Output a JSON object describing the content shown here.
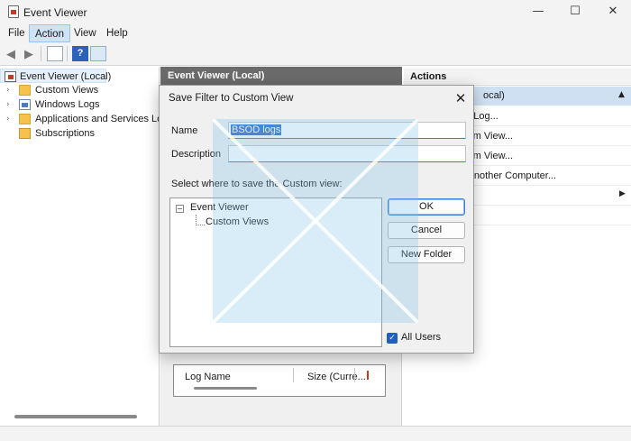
{
  "window": {
    "title": "Event Viewer",
    "controls": {
      "minimize": "—",
      "maximize": "☐",
      "close": "✕"
    }
  },
  "menu": {
    "items": [
      "File",
      "Action",
      "View",
      "Help"
    ]
  },
  "toolbar": {
    "buttons": [
      "back-arrow",
      "forward-arrow",
      "show-hide-tree",
      "help",
      "show-hide-action-pane"
    ],
    "help_glyph": "?"
  },
  "tree": {
    "items": [
      {
        "label": "Event Viewer (Local)",
        "icon": "event-viewer-icon"
      },
      {
        "label": "Custom Views",
        "icon": "folder-icon"
      },
      {
        "label": "Windows Logs",
        "icon": "logs-icon"
      },
      {
        "label": "Applications and Services Log",
        "icon": "folder-icon"
      },
      {
        "label": "Subscriptions",
        "icon": "subscriptions-icon"
      }
    ]
  },
  "center": {
    "header": "Event Viewer (Local)",
    "grid": {
      "col_name": "Log Name",
      "col_size": "Size (Curre..."
    }
  },
  "actions": {
    "header": "Actions",
    "section": "ocal)",
    "items": [
      "ed Log...",
      "stom View...",
      "stom View...",
      "o Another Computer..."
    ]
  },
  "dialog": {
    "title": "Save Filter to Custom View",
    "close_glyph": "✕",
    "name_label": "Name",
    "name_value": "BSOD logs",
    "description_label": "Description",
    "description_value": "",
    "tree_prompt": "Select where to save the Custom view:",
    "tree_root": "Event Viewer",
    "tree_child": "Custom Views",
    "ok_label": "OK",
    "cancel_label": "Cancel",
    "new_folder_label": "New Folder",
    "all_users_label": "All Users",
    "all_users_checked": true,
    "check_glyph": "✓"
  },
  "colors": {
    "accent": "#2f6fd0",
    "selection_bg": "#cfe0f3",
    "header_dark": "#6b6b6b"
  }
}
